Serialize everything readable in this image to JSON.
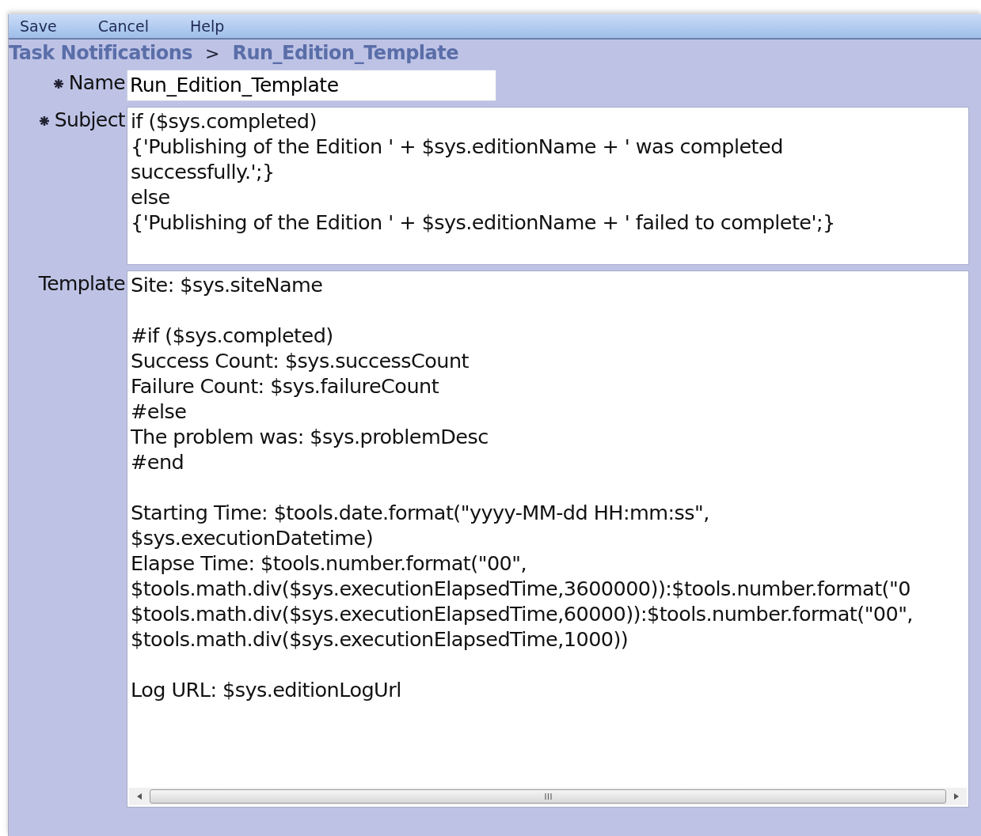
{
  "toolbar": [
    "Save",
    "Cancel",
    "Help"
  ],
  "breadcrumb": {
    "parent": "Task Notifications",
    "separator": ">",
    "current": "Run_Edition_Template"
  },
  "fields": [
    {
      "kind": "input",
      "label": "Name",
      "required": true,
      "value": "Run_Edition_Template"
    },
    {
      "kind": "textarea",
      "label": "Subject",
      "required": true,
      "blocks": [
        [
          "if ($sys.completed)",
          "{'Publishing of the Edition ' + $sys.editionName + ' was completed",
          "successfully.';}",
          "else",
          "{'Publishing of the Edition ' + $sys.editionName + ' failed to complete';}"
        ]
      ]
    },
    {
      "kind": "textarea",
      "label": "Template",
      "required": false,
      "hscroll": true,
      "blocks": [
        [
          "Site: $sys.siteName"
        ],
        [
          "#if ($sys.completed)",
          "Success Count: $sys.successCount",
          "Failure Count: $sys.failureCount",
          "#else",
          "The problem was: $sys.problemDesc",
          "#end"
        ],
        [
          "Starting Time: $tools.date.format(\"yyyy-MM-dd HH:mm:ss\",",
          "$sys.executionDatetime)",
          "Elapse Time: $tools.number.format(\"00\",",
          "$tools.math.div($sys.executionElapsedTime,3600000)):$tools.number.format(\"0",
          "$tools.math.div($sys.executionElapsedTime,60000)):$tools.number.format(\"00\",",
          "$tools.math.div($sys.executionElapsedTime,1000))"
        ],
        [
          "Log URL: $sys.editionLogUrl"
        ]
      ]
    }
  ]
}
